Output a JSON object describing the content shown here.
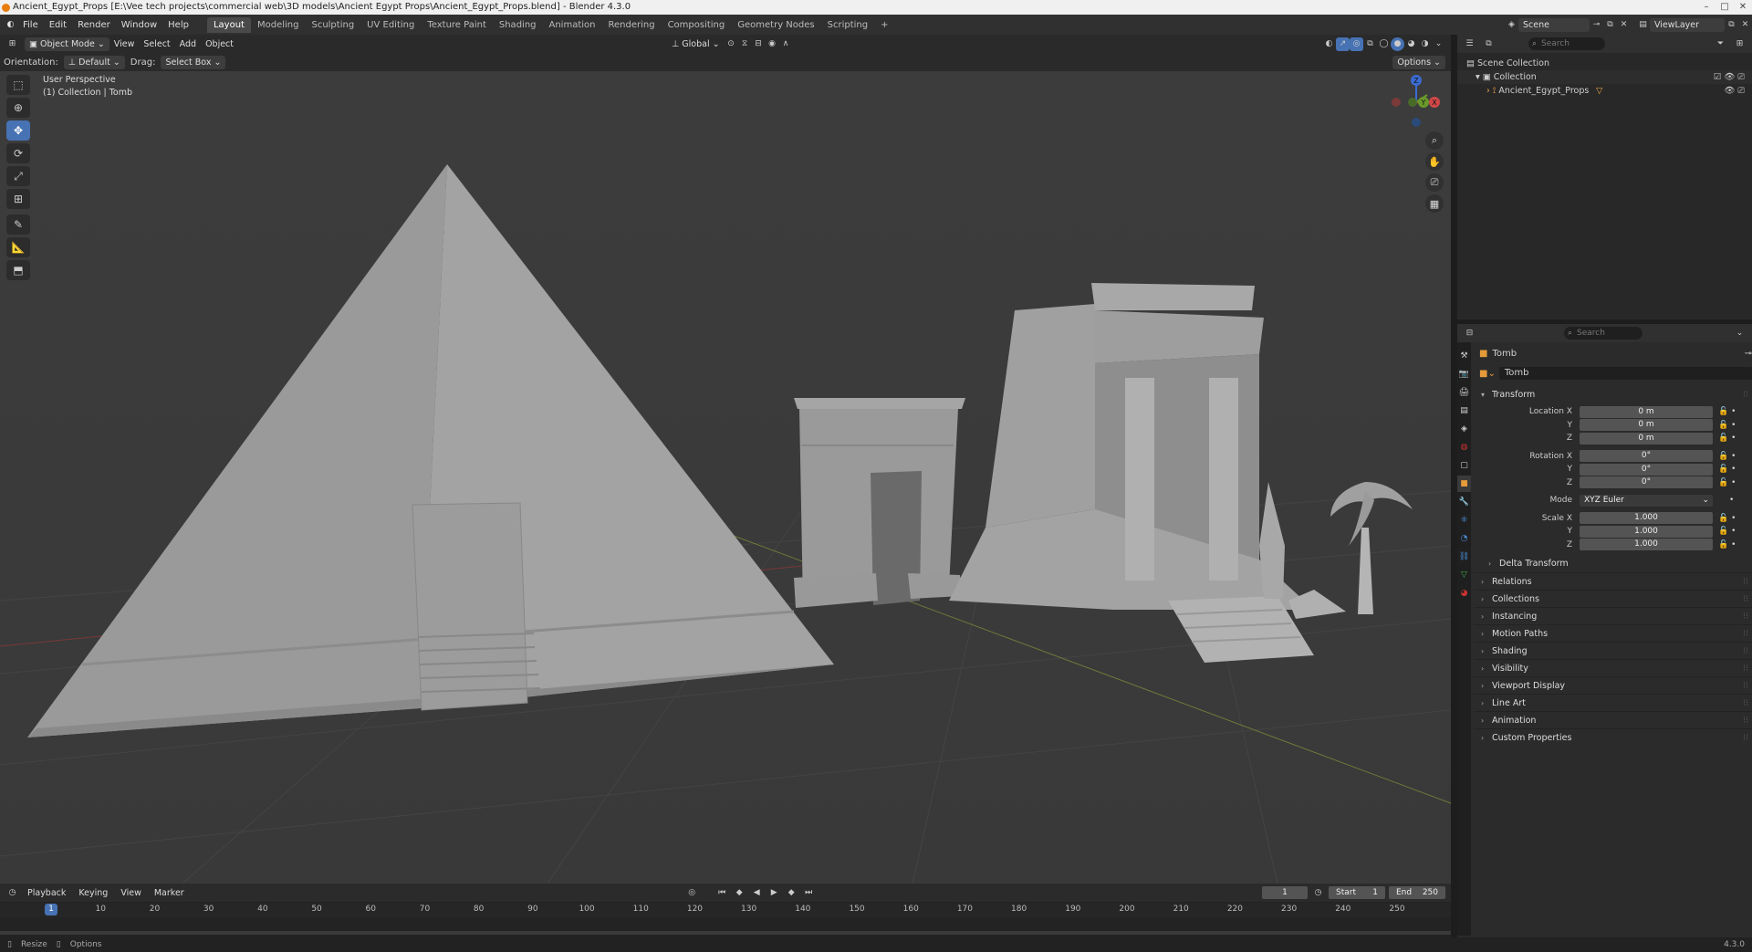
{
  "window": {
    "title": "Ancient_Egypt_Props [E:\\Vee tech projects\\commercial web\\3D models\\Ancient Egypt Props\\Ancient_Egypt_Props.blend] - Blender 4.3.0",
    "minimize": "–",
    "maximize": "□",
    "close": "✕"
  },
  "menu": [
    "File",
    "Edit",
    "Render",
    "Window",
    "Help"
  ],
  "workspaces": [
    "Layout",
    "Modeling",
    "Sculpting",
    "UV Editing",
    "Texture Paint",
    "Shading",
    "Animation",
    "Rendering",
    "Compositing",
    "Geometry Nodes",
    "Scripting"
  ],
  "workspace_add": "+",
  "scene": {
    "label": "Scene",
    "view_layer": "ViewLayer"
  },
  "viewport_header": {
    "mode": "Object Mode",
    "menus": [
      "View",
      "Select",
      "Add",
      "Object"
    ],
    "transform_orientation": "Global",
    "options": "Options"
  },
  "tool_settings": {
    "orientation_label": "Orientation:",
    "orientation_value": "Default",
    "drag_label": "Drag:",
    "drag_value": "Select Box"
  },
  "viewport": {
    "view_name": "User Perspective",
    "collection_info": "(1) Collection | Tomb",
    "gizmo_axes": {
      "z": "Z",
      "y": "Y",
      "x": "X"
    }
  },
  "outliner": {
    "search_placeholder": "Search",
    "items": [
      {
        "label": "Scene Collection"
      },
      {
        "label": "Collection"
      },
      {
        "label": "Ancient_Egypt_Props"
      }
    ]
  },
  "properties": {
    "search_placeholder": "Search",
    "object_title": "Tomb",
    "object_name": "Tomb",
    "transform_label": "Transform",
    "location": {
      "label": "Location X",
      "x": "0 m",
      "y": "0 m",
      "z": "0 m"
    },
    "rotation": {
      "label": "Rotation X",
      "x": "0°",
      "y": "0°",
      "z": "0°"
    },
    "mode": {
      "label": "Mode",
      "value": "XYZ Euler"
    },
    "scale": {
      "label": "Scale X",
      "x": "1.000",
      "y": "1.000",
      "z": "1.000"
    },
    "axis_y": "Y",
    "axis_z": "Z",
    "delta_transform": "Delta Transform",
    "sections": [
      "Relations",
      "Collections",
      "Instancing",
      "Motion Paths",
      "Shading",
      "Visibility",
      "Viewport Display",
      "Line Art",
      "Animation",
      "Custom Properties"
    ]
  },
  "timeline": {
    "menus": [
      "Playback",
      "Keying",
      "View",
      "Marker"
    ],
    "current_frame": "1",
    "start_label": "Start",
    "start": "1",
    "end_label": "End",
    "end": "250",
    "ticks": [
      "10",
      "20",
      "30",
      "40",
      "50",
      "60",
      "70",
      "80",
      "90",
      "100",
      "110",
      "120",
      "130",
      "140",
      "150",
      "160",
      "170",
      "180",
      "190",
      "200",
      "210",
      "220",
      "230",
      "240",
      "250"
    ],
    "playhead": "1"
  },
  "statusbar": {
    "left1": "Resize",
    "left2": "Options",
    "version": "4.3.0"
  }
}
